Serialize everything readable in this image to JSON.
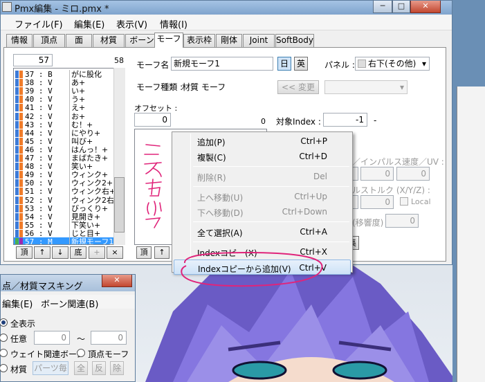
{
  "window": {
    "title": "Pmx編集 - ミロ.pmx *",
    "min_label": "─",
    "max_label": "□",
    "close_label": "✕"
  },
  "menubar": [
    "ファイル(F)",
    "編集(E)",
    "表示(V)",
    "情報(I)"
  ],
  "tabs": [
    "情報",
    "頂点",
    "面",
    "材質",
    "ボーン",
    "モーフ",
    "表示枠",
    "剛体",
    "Joint",
    "SoftBody"
  ],
  "active_tab": "モーフ",
  "morph_list": {
    "index_value": "57",
    "count": "58",
    "items": [
      {
        "num": "37 : B",
        "name": "がに股化",
        "c1": "#3d7bd8",
        "c2": "#f07c2a",
        "selected": false
      },
      {
        "num": "38 : V",
        "name": "あ+",
        "c1": "#3d7bd8",
        "c2": "#f07c2a",
        "selected": false
      },
      {
        "num": "39 : V",
        "name": "い+",
        "c1": "#3d7bd8",
        "c2": "#f07c2a",
        "selected": false
      },
      {
        "num": "40 : V",
        "name": "う+",
        "c1": "#3d7bd8",
        "c2": "#f07c2a",
        "selected": false
      },
      {
        "num": "41 : V",
        "name": "え+",
        "c1": "#3d7bd8",
        "c2": "#f07c2a",
        "selected": false
      },
      {
        "num": "42 : V",
        "name": "お+",
        "c1": "#3d7bd8",
        "c2": "#f07c2a",
        "selected": false
      },
      {
        "num": "43 : V",
        "name": "む！+",
        "c1": "#3d7bd8",
        "c2": "#f07c2a",
        "selected": false
      },
      {
        "num": "44 : V",
        "name": "にやり+",
        "c1": "#3d7bd8",
        "c2": "#f07c2a",
        "selected": false
      },
      {
        "num": "45 : V",
        "name": "叫び+",
        "c1": "#3d7bd8",
        "c2": "#f07c2a",
        "selected": false
      },
      {
        "num": "46 : V",
        "name": "はんっ！+",
        "c1": "#3d7bd8",
        "c2": "#f07c2a",
        "selected": false
      },
      {
        "num": "47 : V",
        "name": "まばたき+",
        "c1": "#3d7bd8",
        "c2": "#f07c2a",
        "selected": false
      },
      {
        "num": "48 : V",
        "name": "笑い+",
        "c1": "#3d7bd8",
        "c2": "#f07c2a",
        "selected": false
      },
      {
        "num": "49 : V",
        "name": "ウィンク+",
        "c1": "#3d7bd8",
        "c2": "#f07c2a",
        "selected": false
      },
      {
        "num": "50 : V",
        "name": "ウィンク2+",
        "c1": "#3d7bd8",
        "c2": "#f07c2a",
        "selected": false
      },
      {
        "num": "51 : V",
        "name": "ウィンク右+",
        "c1": "#3d7bd8",
        "c2": "#f07c2a",
        "selected": false
      },
      {
        "num": "52 : V",
        "name": "ウィンク2右+",
        "c1": "#3d7bd8",
        "c2": "#f07c2a",
        "selected": false
      },
      {
        "num": "53 : V",
        "name": "びっくり+",
        "c1": "#3d7bd8",
        "c2": "#f07c2a",
        "selected": false
      },
      {
        "num": "54 : V",
        "name": "見開き+",
        "c1": "#3d7bd8",
        "c2": "#f07c2a",
        "selected": false
      },
      {
        "num": "55 : V",
        "name": "下笑い+",
        "c1": "#3d7bd8",
        "c2": "#f07c2a",
        "selected": false
      },
      {
        "num": "56 : V",
        "name": "じと目+",
        "c1": "#3d7bd8",
        "c2": "#f07c2a",
        "selected": false
      },
      {
        "num": "57 : M",
        "name": "新規モーフ1",
        "c1": "#4caf50",
        "c2": "#9c27b0",
        "selected": true
      }
    ],
    "buttons": [
      "頂",
      "↑",
      "↓",
      "底",
      "+",
      "×"
    ]
  },
  "props": {
    "name_label": "モーフ名 :",
    "name_value": "新規モーフ1",
    "jp_label": "日",
    "en_label": "英",
    "panel_label": "パネル :",
    "panel_value": "右下(その他)",
    "kind_label": "モーフ種類 :",
    "kind_value": "材質 モーフ",
    "change_label": "<< 変更",
    "offset_label": "オフセット :",
    "offset_start": "0",
    "offset_count": "0",
    "target_label": "対象Index :",
    "target_value": "-1",
    "target_dash": "-",
    "impulse_label": "／インパルス速度／UV :",
    "impulse_vals": [
      "0",
      "0"
    ],
    "torque_label": "ルストルク (X/Y/Z) :",
    "torque_vals": [
      "0",
      "0"
    ],
    "local_label": "Local",
    "rate_label": "(移響度) :",
    "rate_value": "0",
    "collect_label": "集",
    "offset_btns": [
      "頂",
      "↑"
    ]
  },
  "context_menu": [
    {
      "label": "追加(P)",
      "shortcut": "Ctrl+P",
      "enabled": true,
      "highlighted": false
    },
    {
      "label": "複製(C)",
      "shortcut": "Ctrl+D",
      "enabled": true,
      "highlighted": false
    },
    {
      "sep": true
    },
    {
      "label": "削除(R)",
      "shortcut": "Del",
      "enabled": false,
      "highlighted": false
    },
    {
      "sep": true
    },
    {
      "label": "上へ移動(U)",
      "shortcut": "Ctrl+Up",
      "enabled": false,
      "highlighted": false
    },
    {
      "label": "下へ移動(D)",
      "shortcut": "Ctrl+Down",
      "enabled": false,
      "highlighted": false
    },
    {
      "sep": true
    },
    {
      "label": "全て選択(A)",
      "shortcut": "Ctrl+A",
      "enabled": true,
      "highlighted": false
    },
    {
      "sep": true
    },
    {
      "label": "Indexコピー(X)",
      "shortcut": "Ctrl+X",
      "enabled": true,
      "highlighted": false
    },
    {
      "label": "Indexコピーから追加(V)",
      "shortcut": "Ctrl+V",
      "enabled": true,
      "highlighted": true
    }
  ],
  "annotation": {
    "text": "ここで右クリック",
    "color": "#e0247a"
  },
  "mask_window": {
    "title": "点／材質マスキング",
    "close_label": "✕",
    "menu": [
      "編集(E)",
      "ボーン関連(B)"
    ],
    "all_label": "全表示",
    "any_label": "任意",
    "any_from": "0",
    "tilde": "〜",
    "any_to": "0",
    "weight_label": "ウェイト関連ボーン",
    "vertex_morph_label": "頂点モーフ",
    "material_label": "材質",
    "parts_label": "パーツ毎",
    "all_btn": "全",
    "inv_btn": "反",
    "del_btn": "除"
  },
  "colors": {
    "accent": "#3399ff",
    "highlight_ring": "#e0247a"
  }
}
